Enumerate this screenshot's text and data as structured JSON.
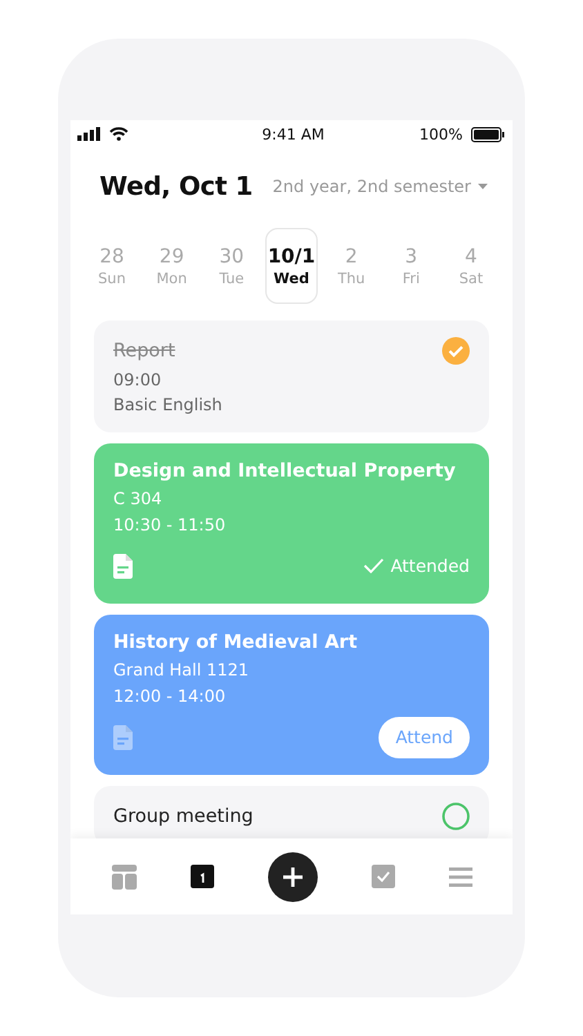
{
  "status_bar": {
    "time": "9:41 AM",
    "battery": "100%"
  },
  "header": {
    "date": "Wed, Oct 1",
    "semester": "2nd year, 2nd semester"
  },
  "days": [
    {
      "date": "28",
      "weekday": "Sun",
      "selected": false
    },
    {
      "date": "29",
      "weekday": "Mon",
      "selected": false
    },
    {
      "date": "30",
      "weekday": "Tue",
      "selected": false
    },
    {
      "date": "10/1",
      "weekday": "Wed",
      "selected": true
    },
    {
      "date": "2",
      "weekday": "Thu",
      "selected": false
    },
    {
      "date": "3",
      "weekday": "Fri",
      "selected": false
    },
    {
      "date": "4",
      "weekday": "Sat",
      "selected": false
    }
  ],
  "items": [
    {
      "kind": "task",
      "title": "Report",
      "time": "09:00",
      "subject": "Basic English",
      "done": true,
      "color": "#fbb040"
    },
    {
      "kind": "class",
      "title": "Design and Intellectual Property",
      "room": "C 304",
      "time": "10:30 - 11:50",
      "color": "#64d68a",
      "attended": true,
      "status": "Attended"
    },
    {
      "kind": "class",
      "title": "History of Medieval Art",
      "room": "Grand Hall 1121",
      "time": "12:00 - 14:00",
      "color": "#6aa5fb",
      "attended": false,
      "status": "Attend"
    },
    {
      "kind": "task",
      "title": "Group meeting",
      "done": false,
      "color": "#4cc46a"
    }
  ],
  "nav": [
    {
      "kind": "grid",
      "selected": false
    },
    {
      "kind": "calendar",
      "selected": true
    },
    {
      "kind": "add",
      "selected": false
    },
    {
      "kind": "check",
      "selected": false
    },
    {
      "kind": "menu",
      "selected": false
    }
  ]
}
